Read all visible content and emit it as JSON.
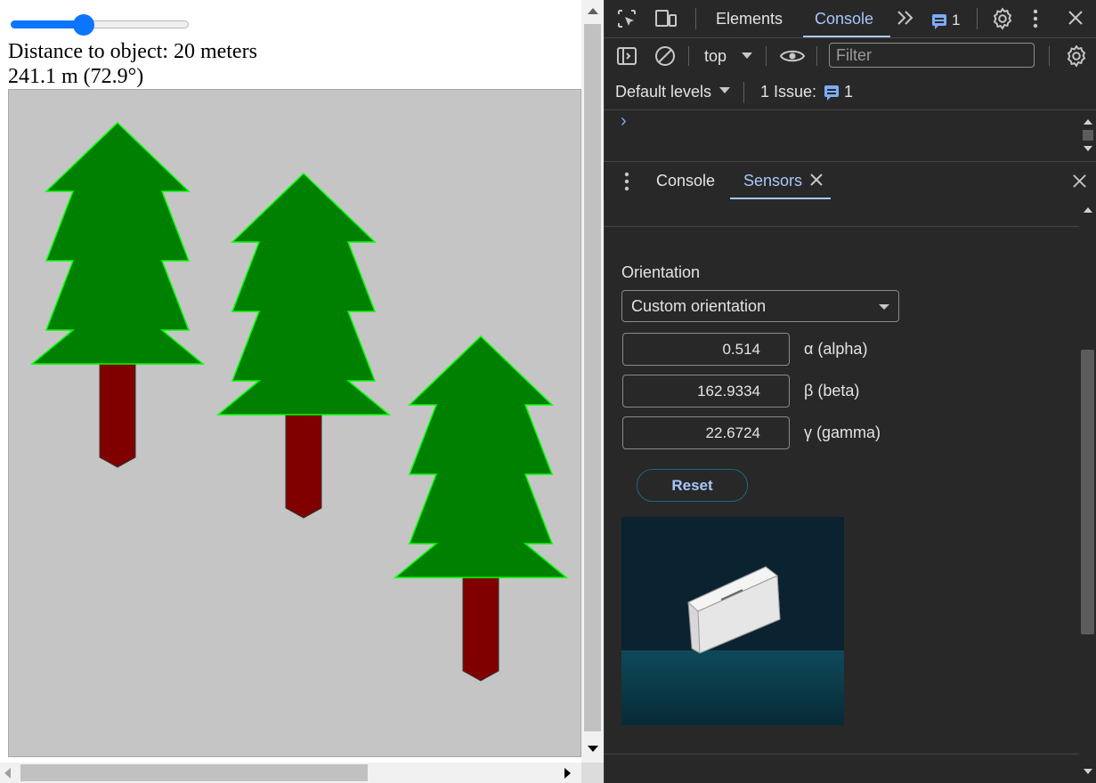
{
  "page": {
    "slider": {
      "min": 0,
      "max": 100,
      "value": 40
    },
    "distance_text": "Distance to object: 20 meters",
    "reading_text": "241.1 m (72.9°)",
    "scene": {
      "background": "#c5c5c5",
      "foliage_color": "#008000",
      "foliage_outline": "#00ff00",
      "trunk_color": "#800000"
    }
  },
  "devtools": {
    "top_tabs": [
      {
        "label": "Elements",
        "active": false
      },
      {
        "label": "Console",
        "active": true
      }
    ],
    "top_icons": [
      "inspect-element-icon",
      "device-toolbar-icon",
      "more-tabs-chevron-icon",
      "issues-message-icon",
      "settings-gear-icon",
      "kebab-menu-icon",
      "close-icon"
    ],
    "issue_count_badge": "1",
    "console_toolbar": {
      "context": "top",
      "filter_placeholder": "Filter",
      "levels": "Default levels",
      "issues_label": "1 Issue:",
      "issues_count": "1"
    },
    "prompt_symbol": "›",
    "drawer_tabs": [
      {
        "label": "Console",
        "active": false
      },
      {
        "label": "Sensors",
        "active": true
      }
    ],
    "sensors": {
      "orientation_label": "Orientation",
      "orientation_selected": "Custom orientation",
      "alpha_value": "0.514",
      "alpha_label": "α (alpha)",
      "beta_value": "162.9334",
      "beta_label": "β (beta)",
      "gamma_value": "22.6724",
      "gamma_label": "γ (gamma)",
      "reset_label": "Reset"
    },
    "colors": {
      "background": "#282828",
      "accent": "#a8c7fa",
      "preview_sky": "#0b2230",
      "preview_floor": "#0e4a5a"
    }
  }
}
